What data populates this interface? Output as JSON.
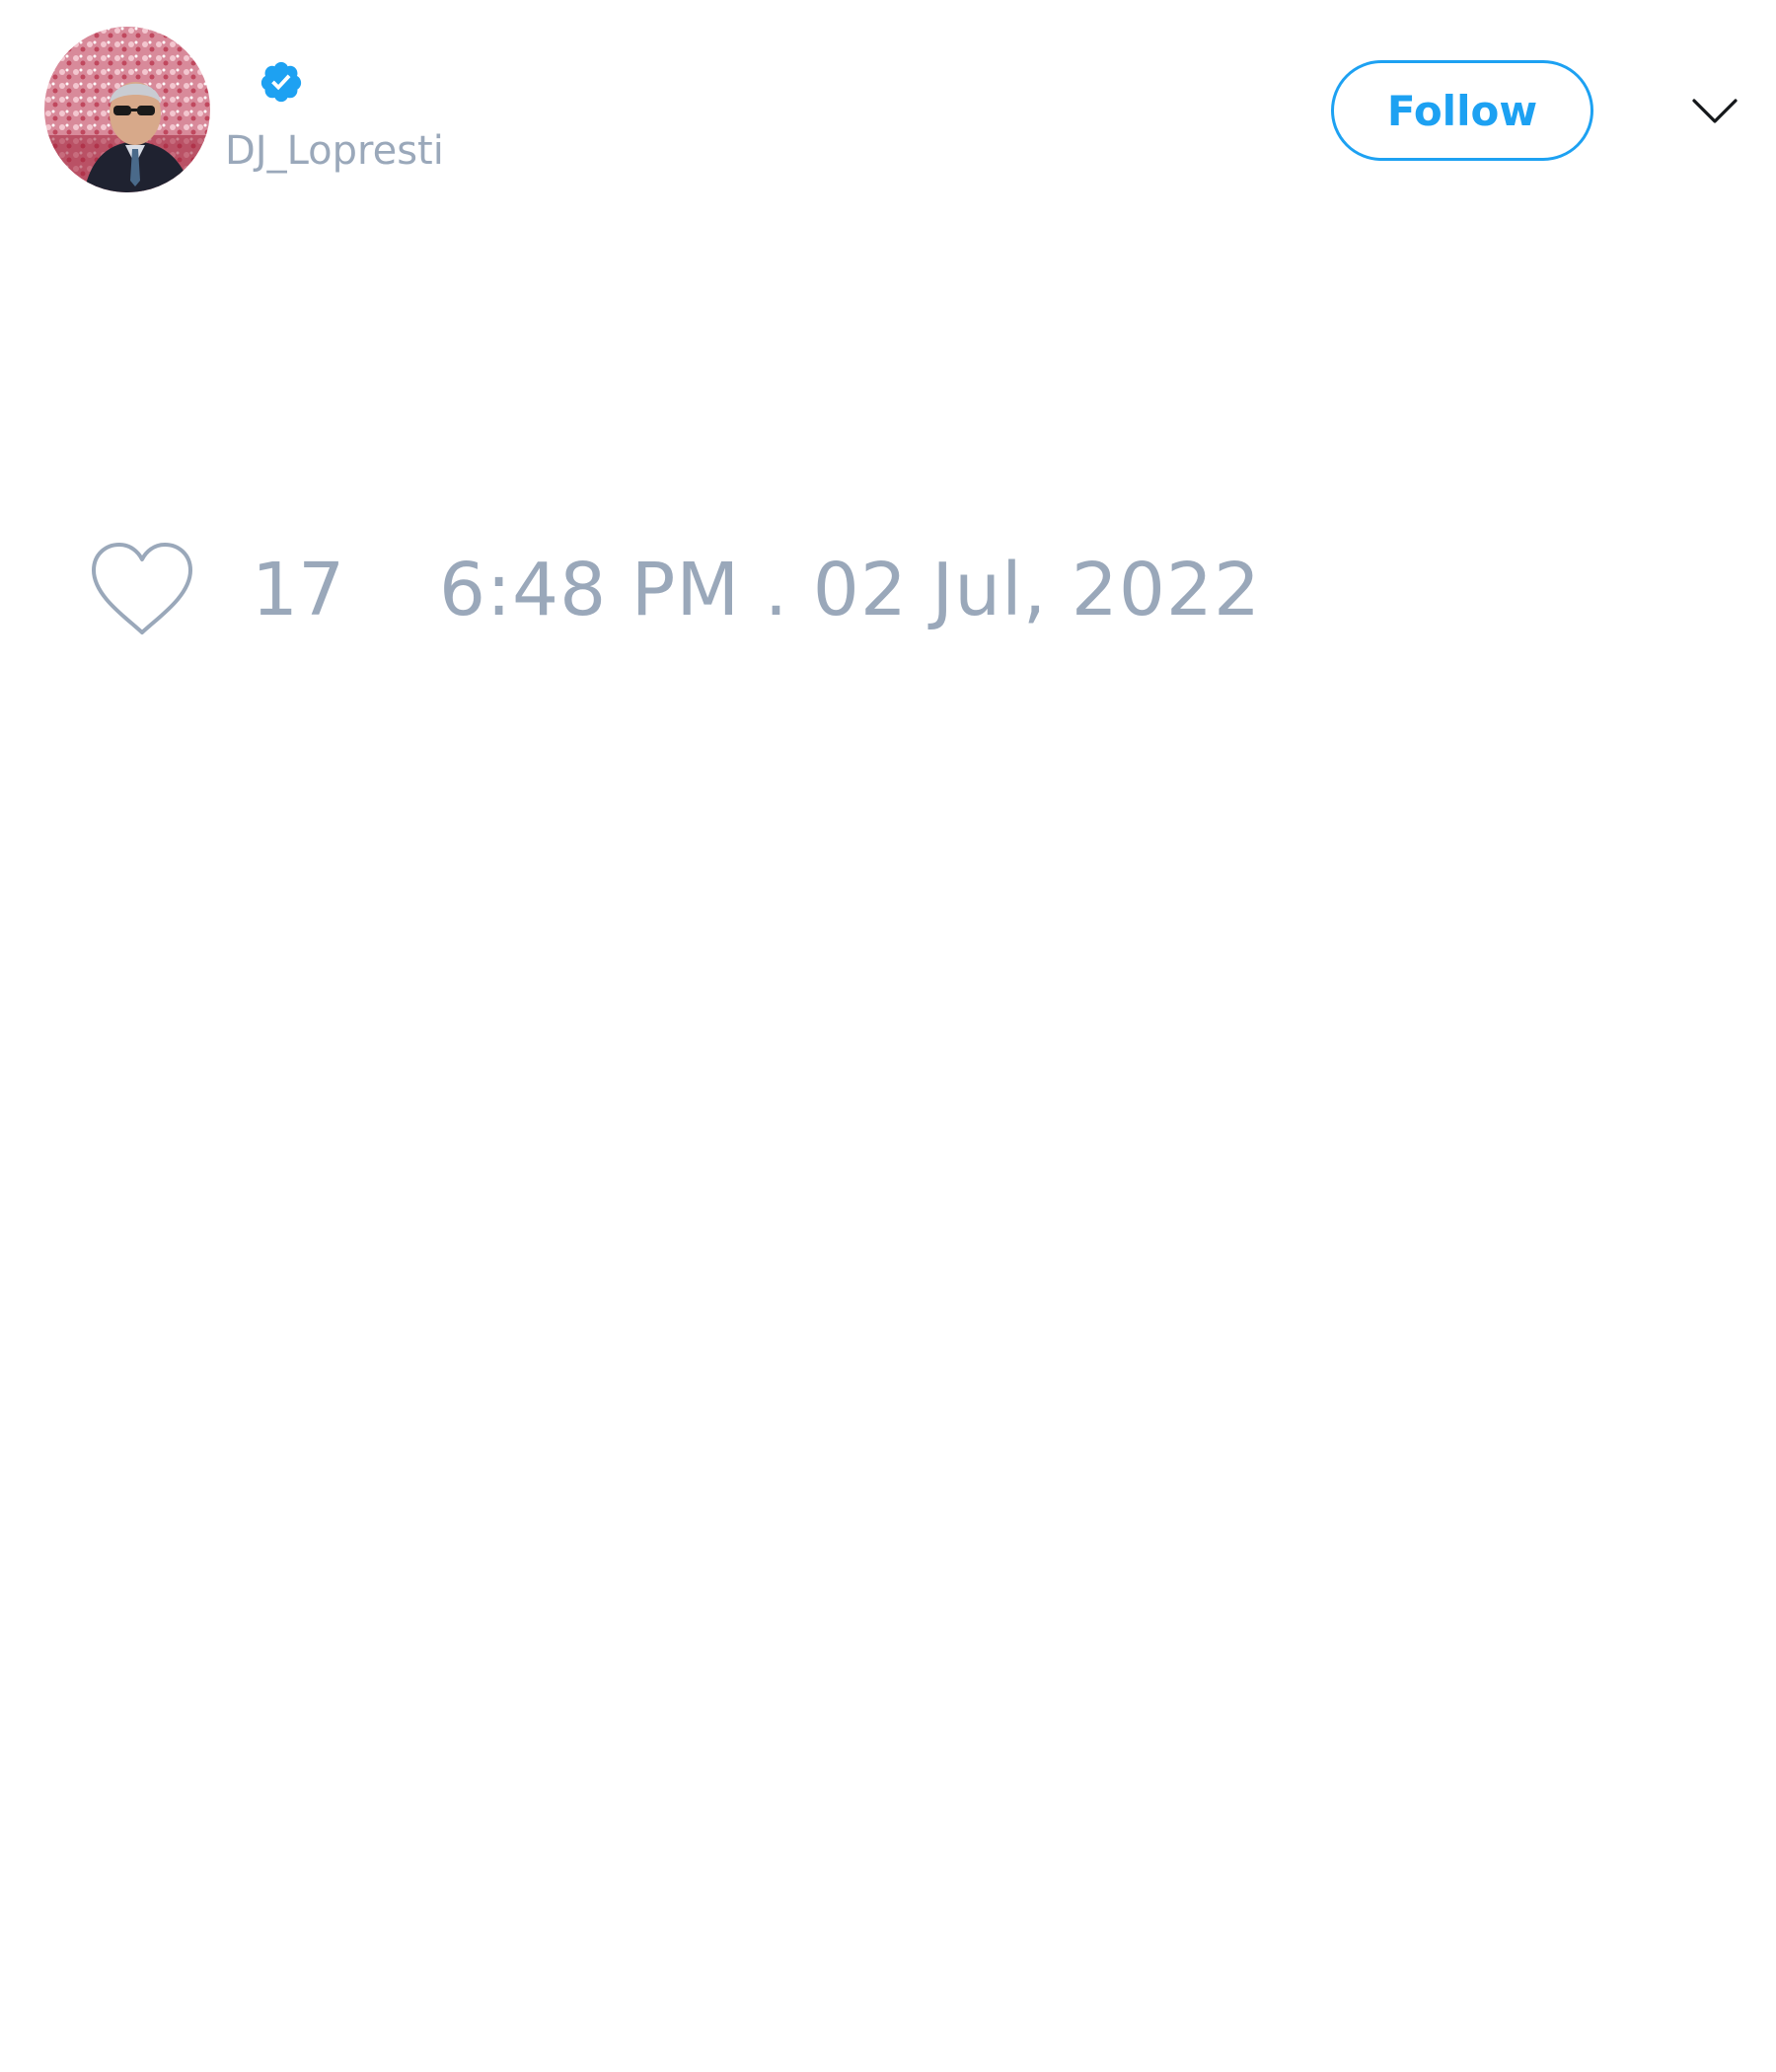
{
  "tweet": {
    "author": {
      "handle": "DJ_Lopresti",
      "verified": true,
      "avatar_icon": "profile-photo"
    },
    "follow_label": "Follow",
    "menu_icon": "chevron-down-icon",
    "likes": {
      "icon": "heart-outline-icon",
      "count": "17"
    },
    "timestamp": "6:48 PM . 02 Jul, 2022"
  },
  "colors": {
    "accent": "#1da1f2",
    "muted_text": "#9aa8ba",
    "background": "#ffffff"
  }
}
